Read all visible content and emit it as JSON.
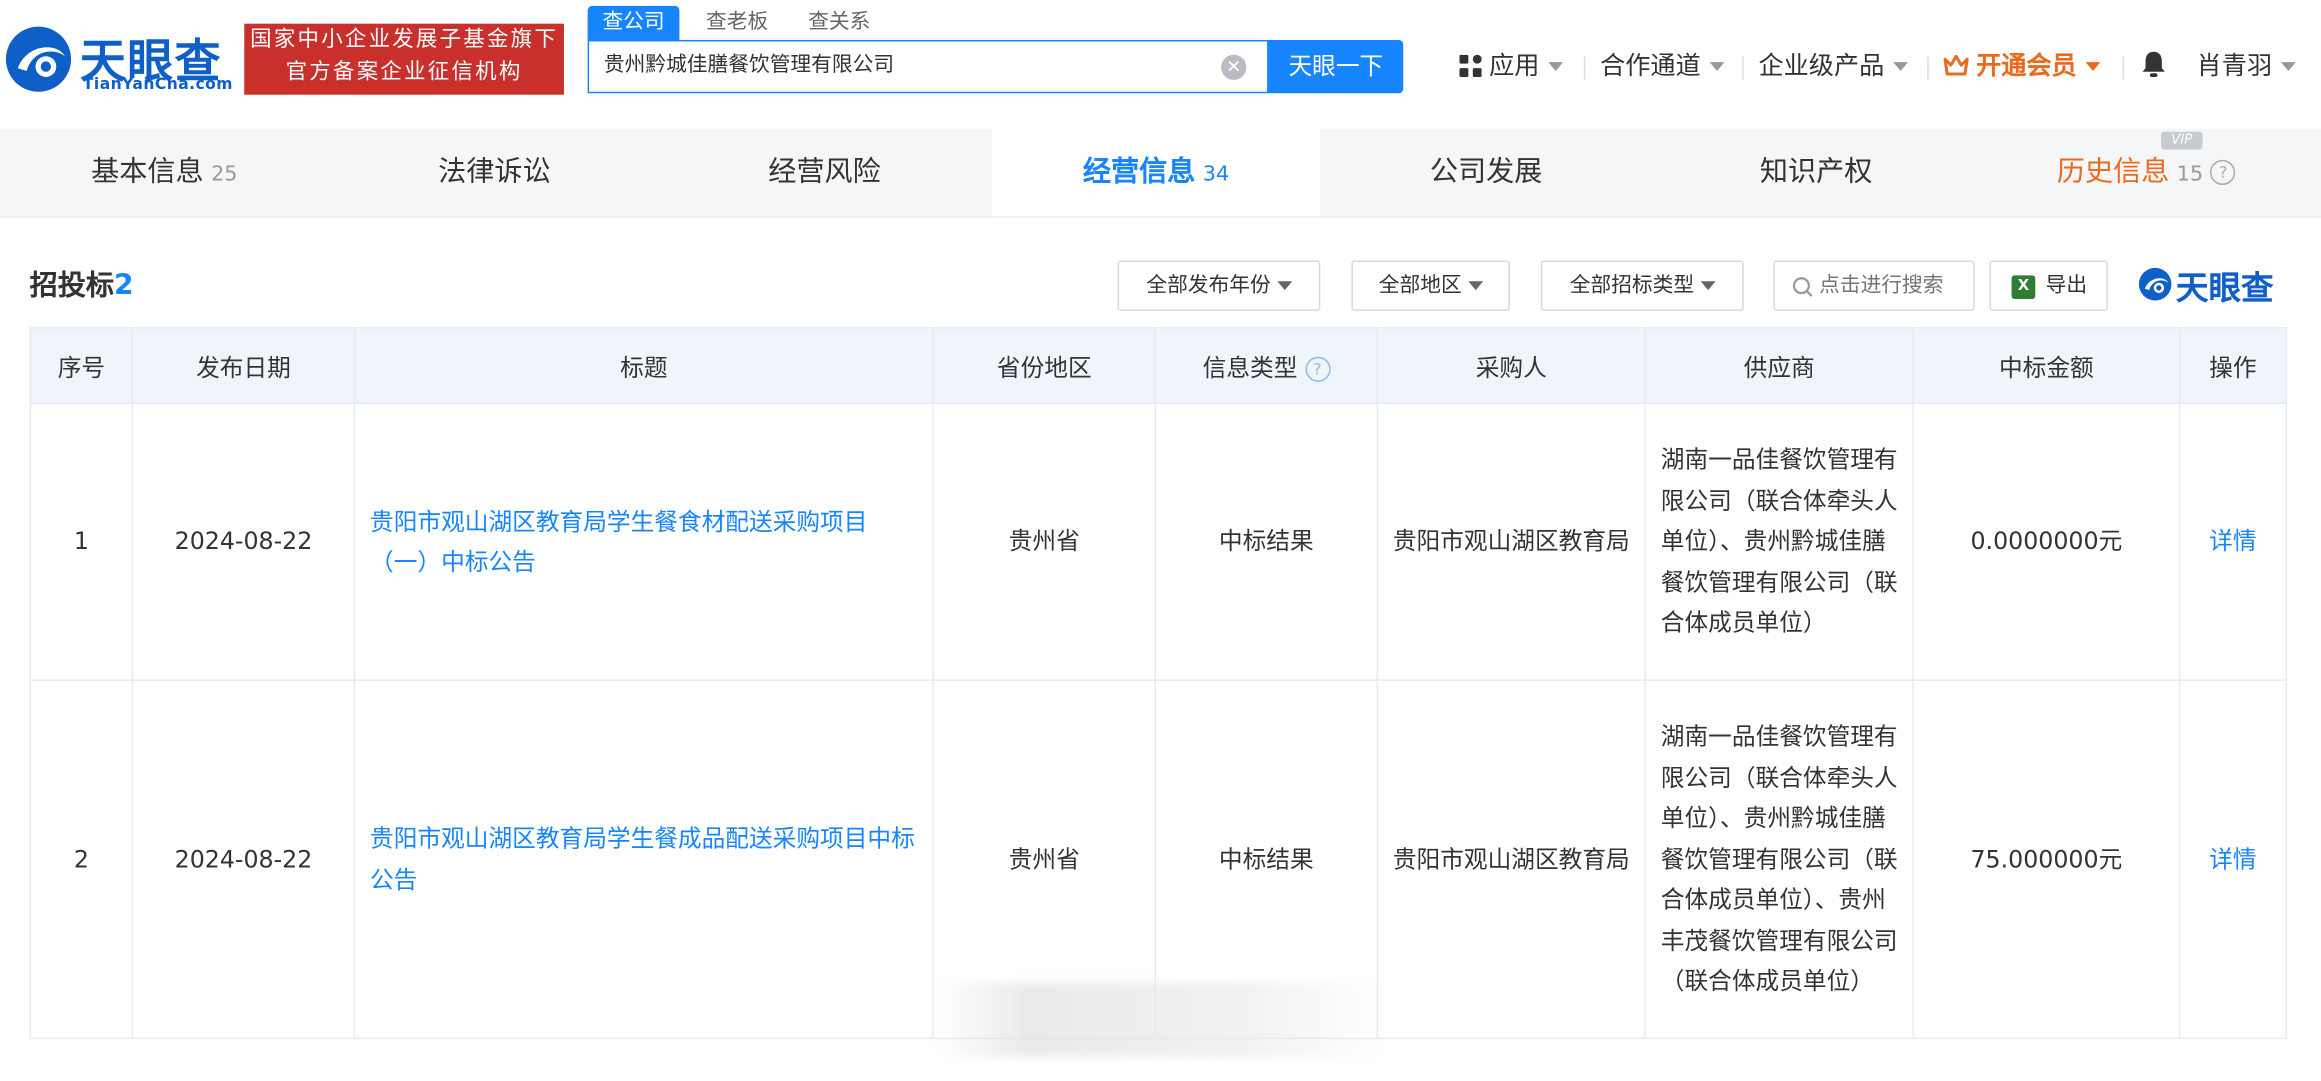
{
  "header": {
    "logo_cn": "天眼查",
    "logo_en": "TianYanCha.com",
    "gov_badge": [
      "国家中小企业发展子基金旗下",
      "官方备案企业征信机构"
    ],
    "search_tabs": [
      "查公司",
      "查老板",
      "查关系"
    ],
    "search_value": "贵州黔城佳膳餐饮管理有限公司",
    "search_button": "天眼一下",
    "nav": {
      "apps": "应用",
      "partner": "合作通道",
      "enterprise": "企业级产品",
      "vip": "开通会员",
      "user": "肖青羽"
    }
  },
  "tabs": [
    {
      "label": "基本信息",
      "count": "25"
    },
    {
      "label": "法律诉讼",
      "count": ""
    },
    {
      "label": "经营风险",
      "count": ""
    },
    {
      "label": "经营信息",
      "count": "34"
    },
    {
      "label": "公司发展",
      "count": ""
    },
    {
      "label": "知识产权",
      "count": ""
    },
    {
      "label": "历史信息",
      "count": "15"
    }
  ],
  "vip_tag": "VIP",
  "section": {
    "title": "招投标",
    "count": "2",
    "filters": [
      "全部发布年份",
      "全部地区",
      "全部招标类型"
    ],
    "search_placeholder": "点击进行搜索",
    "export": "导出",
    "brand": "天眼查"
  },
  "table": {
    "headers": [
      "序号",
      "发布日期",
      "标题",
      "省份地区",
      "信息类型",
      "采购人",
      "供应商",
      "中标金额",
      "操作"
    ],
    "rows": [
      {
        "no": "1",
        "date": "2024-08-22",
        "title": "贵阳市观山湖区教育局学生餐食材配送采购项目（一）中标公告",
        "region": "贵州省",
        "type": "中标结果",
        "buyer": "贵阳市观山湖区教育局",
        "supplier": "湖南一品佳餐饮管理有限公司（联合体牵头人单位）、贵州黔城佳膳餐饮管理有限公司（联合体成员单位）",
        "amount": "0.0000000元",
        "action": "详情"
      },
      {
        "no": "2",
        "date": "2024-08-22",
        "title": "贵阳市观山湖区教育局学生餐成品配送采购项目中标公告",
        "region": "贵州省",
        "type": "中标结果",
        "buyer": "贵阳市观山湖区教育局",
        "supplier": "湖南一品佳餐饮管理有限公司（联合体牵头人单位）、贵州黔城佳膳餐饮管理有限公司（联合体成员单位）、贵州丰茂餐饮管理有限公司（联合体成员单位）",
        "amount": "75.000000元",
        "action": "详情"
      }
    ]
  },
  "colors": {
    "brand_blue": "#1785ff",
    "logo_blue": "#0f5fc8",
    "badge_red": "#c9302c",
    "vip_orange": "#e86b1e"
  }
}
